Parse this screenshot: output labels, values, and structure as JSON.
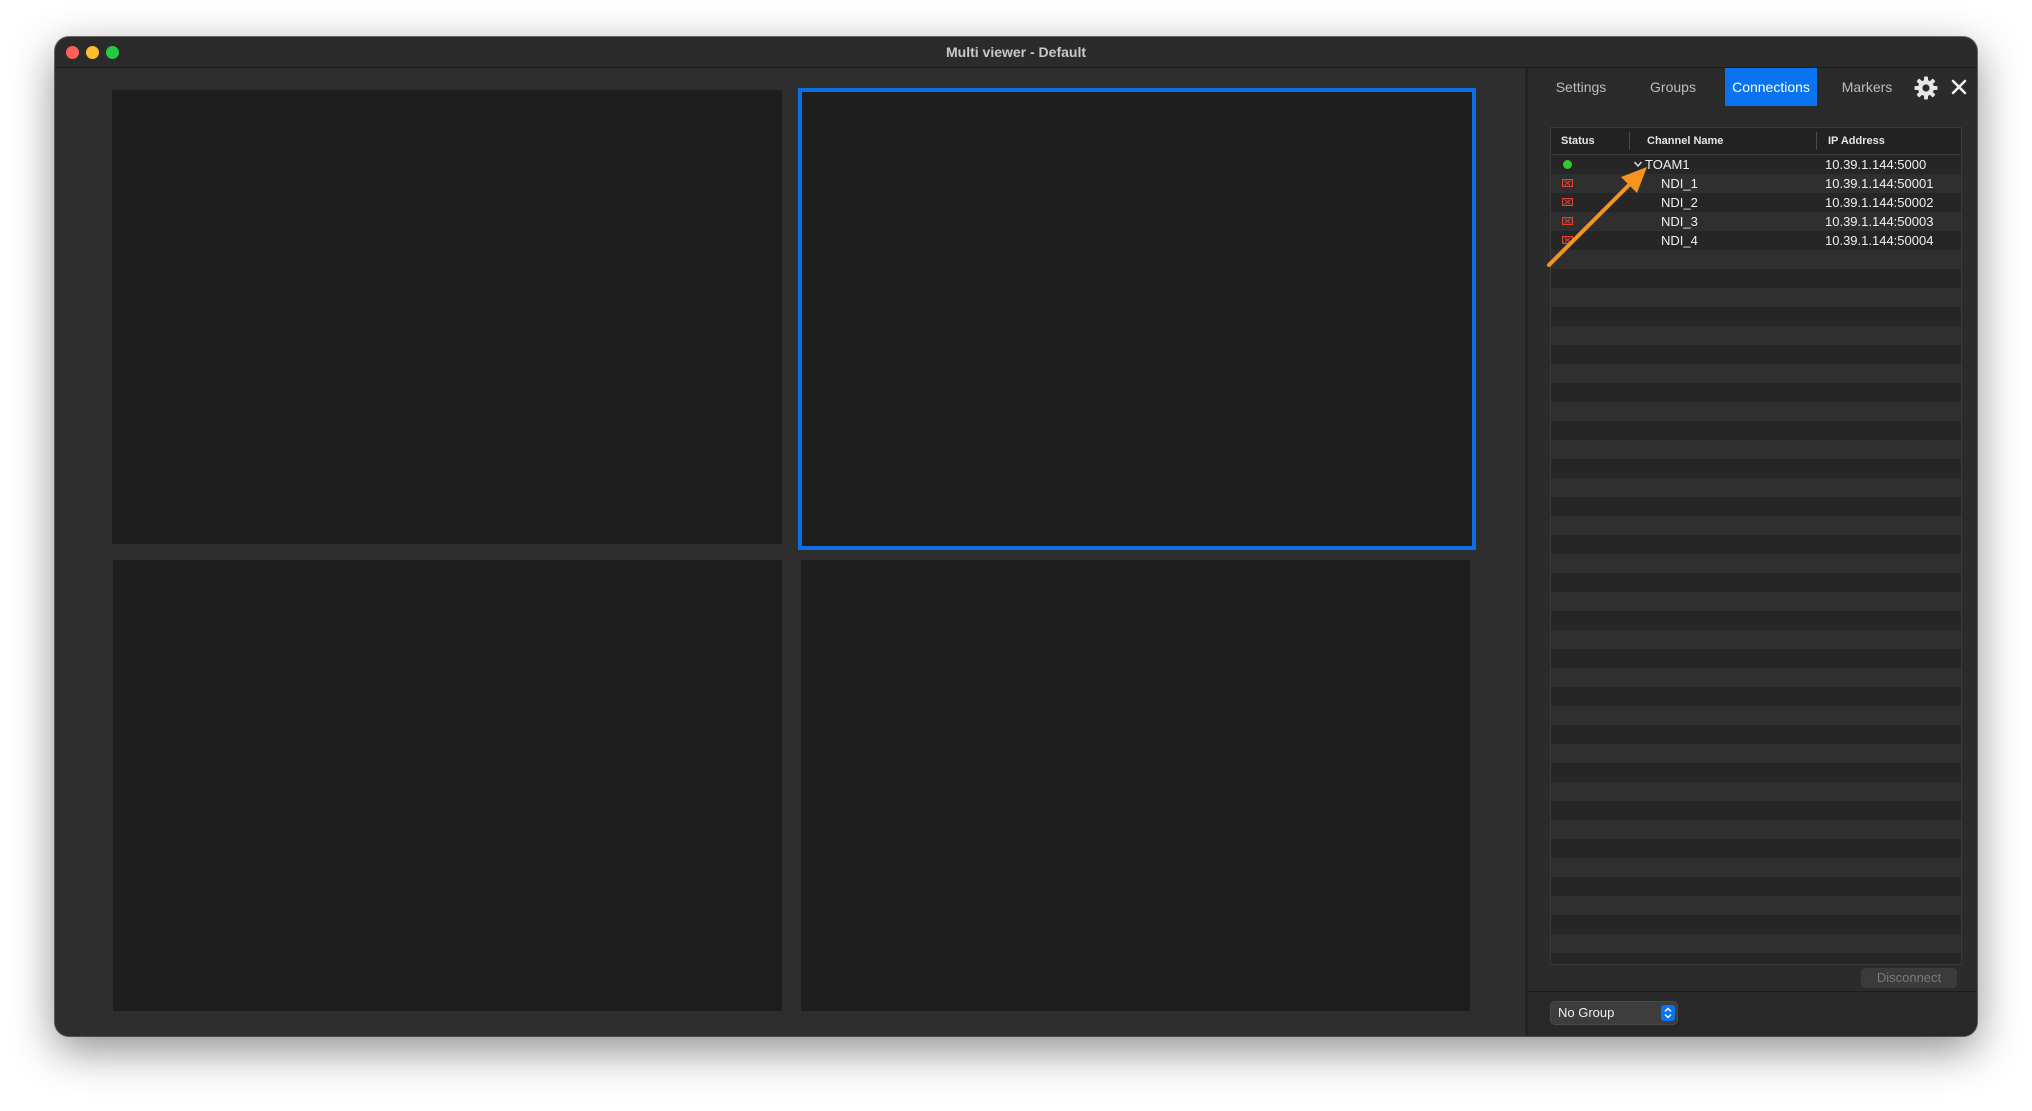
{
  "window": {
    "title": "Multi viewer - Default"
  },
  "tabs": [
    {
      "label": "Settings"
    },
    {
      "label": "Groups"
    },
    {
      "label": "Connections",
      "active": true
    },
    {
      "label": "Markers"
    }
  ],
  "icons": {
    "settings": "gear-icon",
    "close": "close-icon"
  },
  "table": {
    "headers": {
      "status": "Status",
      "channel_name": "Channel Name",
      "ip_address": "IP Address"
    },
    "rows": [
      {
        "status": "connected",
        "name": "TOAM1",
        "ip": "10.39.1.144:5000",
        "expanded": true
      },
      {
        "status": "error",
        "name": "NDI_1",
        "ip": "10.39.1.144:50001"
      },
      {
        "status": "error",
        "name": "NDI_2",
        "ip": "10.39.1.144:50002"
      },
      {
        "status": "error",
        "name": "NDI_3",
        "ip": "10.39.1.144:50003"
      },
      {
        "status": "error",
        "name": "NDI_4",
        "ip": "10.39.1.144:50004"
      }
    ]
  },
  "buttons": {
    "disconnect": "Disconnect"
  },
  "group_select": {
    "value": "No Group"
  },
  "colors": {
    "accent": "#0a74f0",
    "selected_tile_border": "#0d6fe6",
    "status_connected": "#39c72f",
    "status_error": "#e0442f",
    "annotation_arrow": "#f7941d"
  }
}
